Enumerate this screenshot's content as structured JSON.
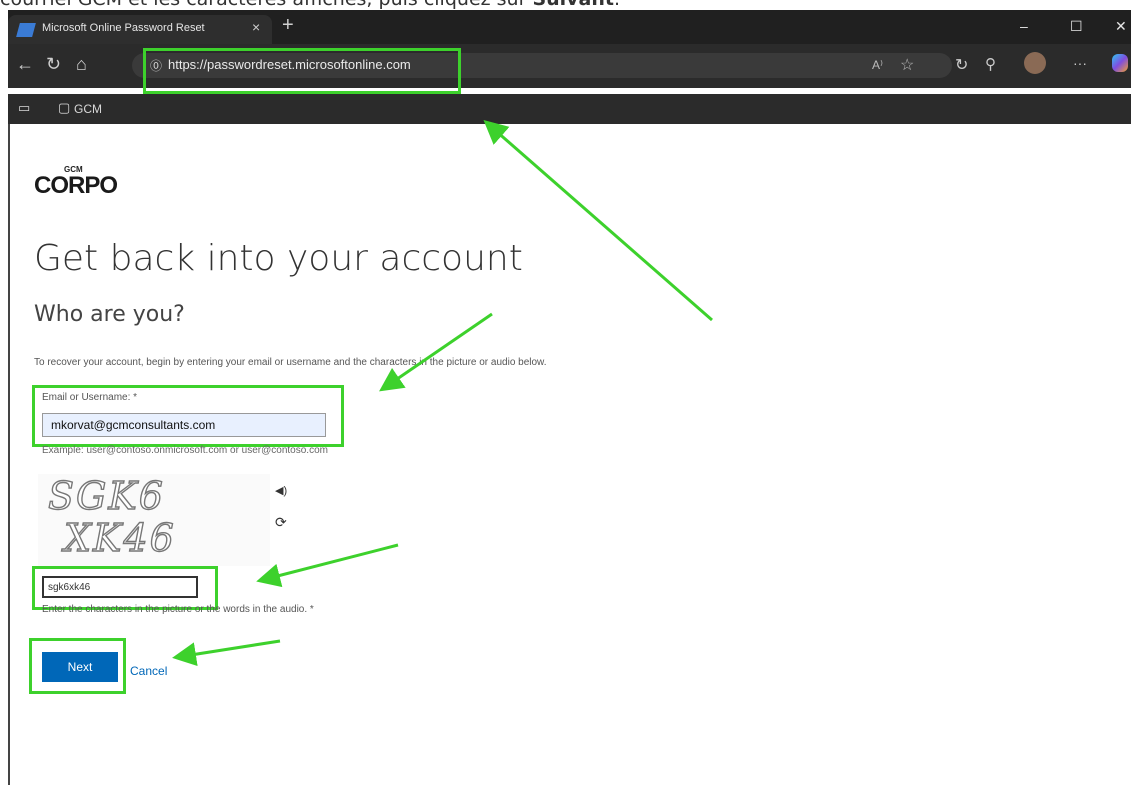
{
  "caption": {
    "text_before": "courriel GCM et les caractères affichés, puis cliquez sur ",
    "bold": "Suivant"
  },
  "browser": {
    "tab_title": "Microsoft Online Password Reset",
    "tab_close": "×",
    "new_tab": "+",
    "window_controls": [
      "–",
      "☐",
      "✕"
    ],
    "url": "https://passwordreset.microsoftonline.com",
    "read_aloud": "A⁾",
    "favorite": "☆",
    "toolbar_icons": [
      "refresh-icon",
      "extensions-icon",
      "profile-icon",
      "more-icon",
      "copilot-icon"
    ],
    "more": "···",
    "bookmark": "GCM"
  },
  "page": {
    "logo_top": "GCM",
    "logo": "CORPO",
    "heading": "Get back into your account",
    "subheading": "Who are you?",
    "intro": "To recover your account, begin by entering your email or username and the characters in the picture or audio below.",
    "email_label": "Email or Username: *",
    "email_value": "mkorvat@gcmconsultants.com",
    "example": "Example: user@contoso.onmicrosoft.com or user@contoso.com",
    "captcha_line1": "SGK6",
    "captcha_line2": "XK46",
    "captcha_value": "sgk6xk46",
    "captcha_label": "Enter the characters in the picture or the words in the audio. *",
    "next": "Next",
    "cancel": "Cancel"
  },
  "colors": {
    "highlight": "#3dd12c",
    "primary": "#0067b8",
    "chrome": "#202020"
  }
}
